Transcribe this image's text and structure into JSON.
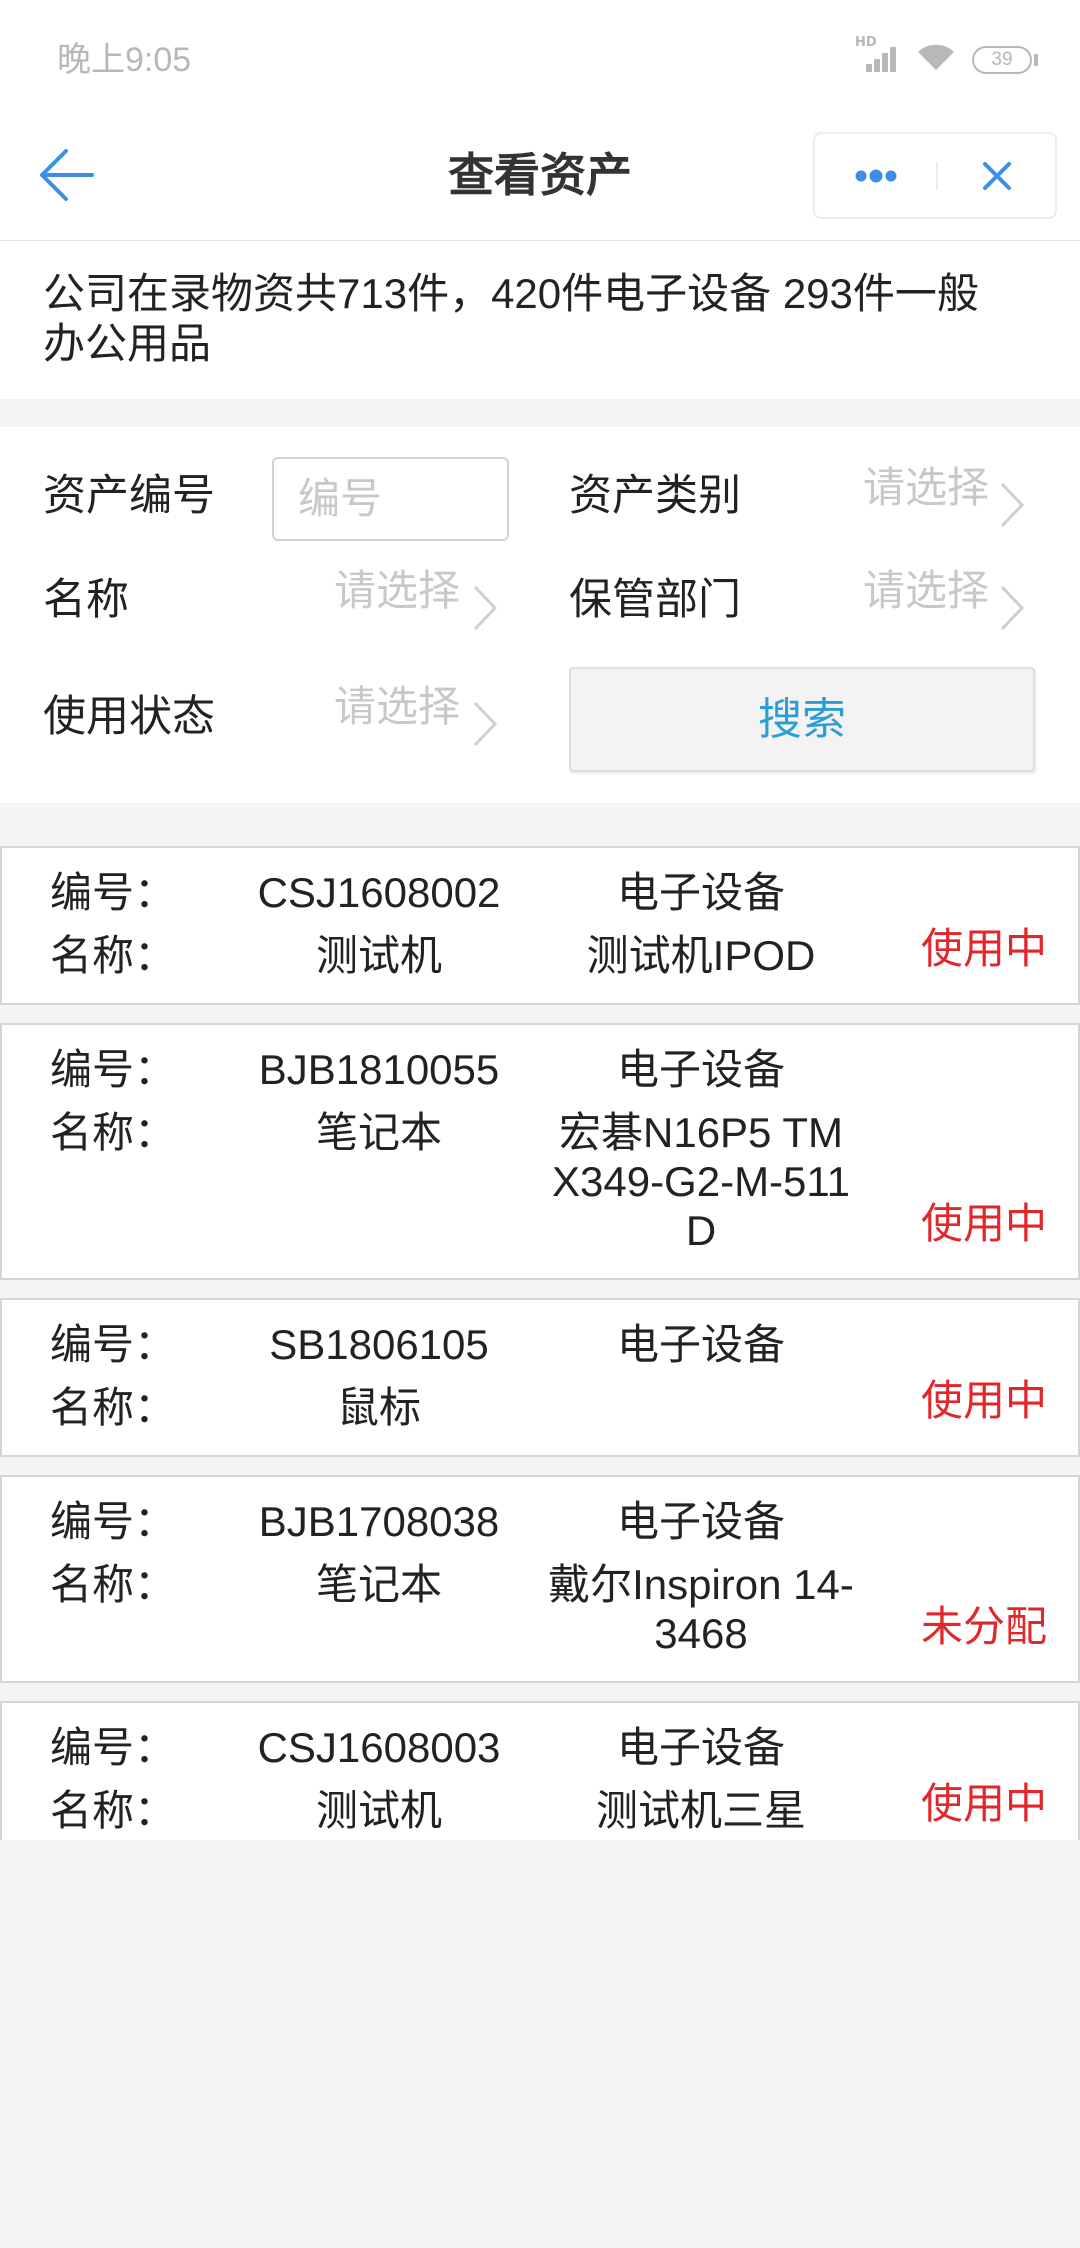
{
  "status_bar": {
    "time": "晚上9:05",
    "network_label": "HD",
    "battery_level": "39",
    "icons": [
      "signal-icon",
      "wifi-icon",
      "battery-icon"
    ]
  },
  "header": {
    "title": "查看资产",
    "back_icon": "back-arrow-icon",
    "more_icon": "more-dots-icon",
    "close_icon": "close-icon"
  },
  "summary": {
    "text": "公司在录物资共713件，420件电子设备 293件一般办公用品"
  },
  "filters": {
    "asset_number": {
      "label": "资产编号",
      "placeholder": "编号"
    },
    "asset_category": {
      "label": "资产类别",
      "placeholder": "请选择"
    },
    "name": {
      "label": "名称",
      "placeholder": "请选择"
    },
    "custody_department": {
      "label": "保管部门",
      "placeholder": "请选择"
    },
    "usage_status": {
      "label": "使用状态",
      "placeholder": "请选择"
    },
    "search_button": "搜索",
    "picker_icon": "chevron-right-icon"
  },
  "asset_list": {
    "labels": {
      "code": "编号：",
      "name": "名称："
    },
    "items": [
      {
        "code": "CSJ1608002",
        "category": "电子设备",
        "name": "测试机",
        "model": "测试机IPOD",
        "status": "使用中"
      },
      {
        "code": "BJB1810055",
        "category": "电子设备",
        "name": "笔记本",
        "model": "宏碁N16P5 TM X349-G2-M-511 D",
        "status": "使用中"
      },
      {
        "code": "SB1806105",
        "category": "电子设备",
        "name": "鼠标",
        "status": "使用中"
      },
      {
        "code": "BJB1708038",
        "category": "电子设备",
        "name": "笔记本",
        "model": "戴尔Inspiron 14-3468",
        "status": "未分配"
      },
      {
        "code": "CSJ1608003",
        "category": "电子设备",
        "name": "测试机",
        "model": "测试机三星",
        "status": "使用中"
      }
    ]
  },
  "colors": {
    "accent": "#3d8ee8",
    "search_text": "#2a9fd6",
    "status_red": "#e3262a",
    "placeholder": "#c8c8c8",
    "text": "#222222",
    "page_background": "#f4f4f4"
  }
}
